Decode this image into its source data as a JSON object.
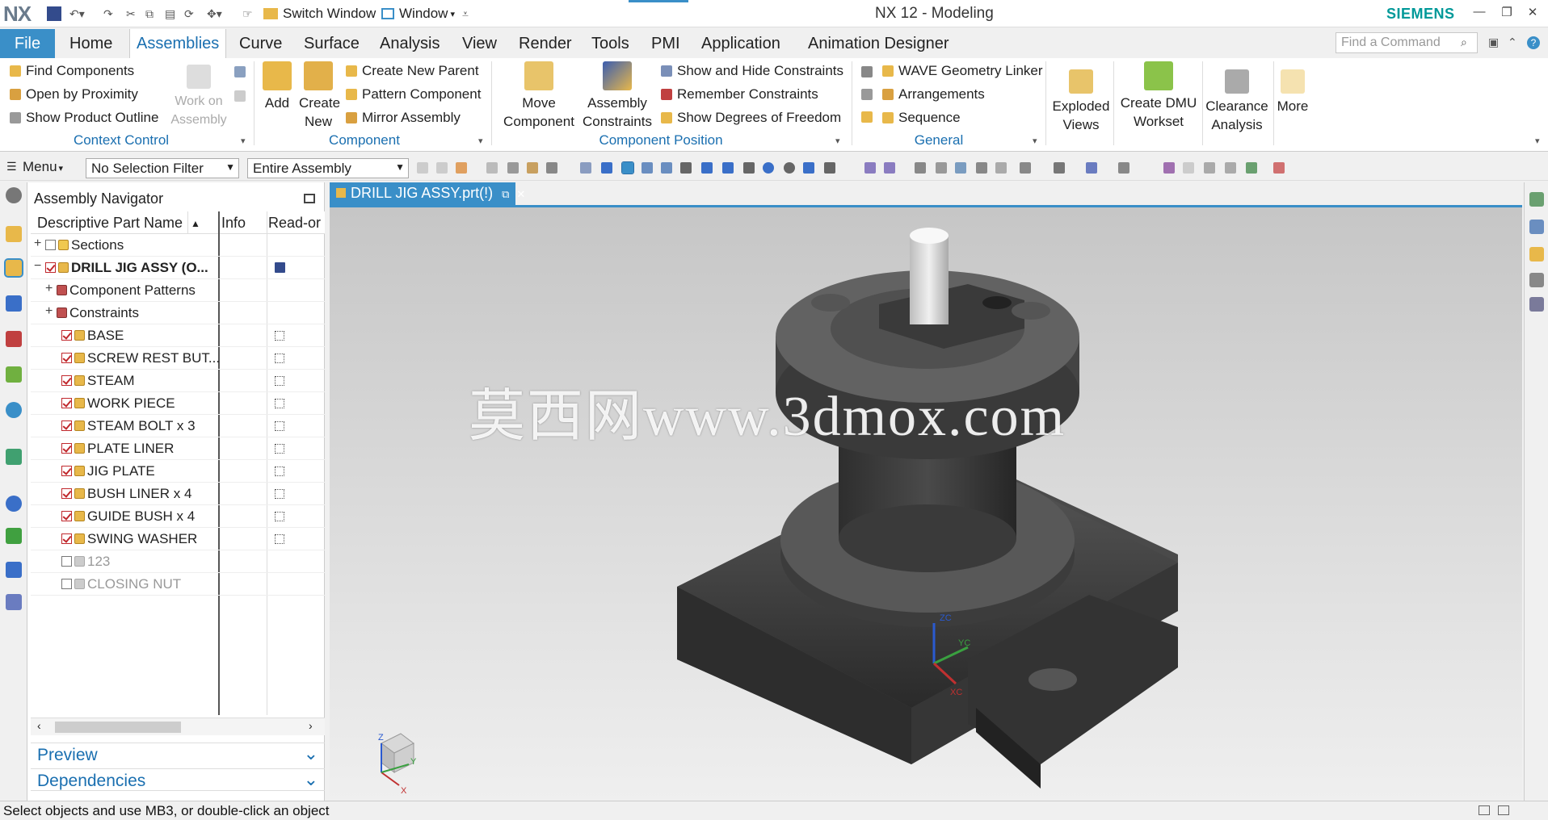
{
  "titlebar": {
    "logo": "NX",
    "switch_window": "Switch Window",
    "window_menu": "Window",
    "app_title": "NX 12 - Modeling",
    "brand": "SIEMENS"
  },
  "tabs": {
    "file": "File",
    "items": [
      "Home",
      "Assemblies",
      "Curve",
      "Surface",
      "Analysis",
      "View",
      "Render",
      "Tools",
      "PMI",
      "Application",
      "Animation Designer"
    ],
    "active": "Assemblies",
    "find_command_placeholder": "Find a Command"
  },
  "ribbon": {
    "context_control": {
      "label": "Context Control",
      "items": [
        "Find Components",
        "Open by Proximity",
        "Show Product Outline"
      ],
      "work_on_assembly": "Work on Assembly"
    },
    "component": {
      "label": "Component",
      "add": "Add",
      "create_new": "Create New",
      "items": [
        "Create New Parent",
        "Pattern Component",
        "Mirror Assembly"
      ]
    },
    "component_position": {
      "label": "Component Position",
      "move_component": "Move Component",
      "assembly_constraints": "Assembly Constraints",
      "items": [
        "Show and Hide Constraints",
        "Remember Constraints",
        "Show Degrees of Freedom"
      ]
    },
    "general": {
      "label": "General",
      "items": [
        "WAVE Geometry Linker",
        "Arrangements",
        "Sequence"
      ]
    },
    "exploded_views": "Exploded Views",
    "create_dmu_worksheet": "Create DMU Workset",
    "clearance_analysis": "Clearance Analysis",
    "more": "More"
  },
  "toolbar2": {
    "menu": "Menu",
    "selection_filter": "No Selection Filter",
    "scope": "Entire Assembly"
  },
  "navigator": {
    "title": "Assembly Navigator",
    "columns": [
      "Descriptive Part Name",
      "Info",
      "Read-or"
    ],
    "rows": [
      {
        "label": "Sections",
        "level": 0,
        "expander": "+",
        "checked": false,
        "bold": false,
        "dim": false,
        "type": "folder"
      },
      {
        "label": "DRILL JIG ASSY (O...",
        "level": 0,
        "expander": "−",
        "checked": true,
        "bold": true,
        "dim": false,
        "type": "assy"
      },
      {
        "label": "Component Patterns",
        "level": 1,
        "expander": "+",
        "checked": null,
        "bold": false,
        "dim": false,
        "type": "pattern"
      },
      {
        "label": "Constraints",
        "level": 1,
        "expander": "+",
        "checked": null,
        "bold": false,
        "dim": false,
        "type": "constraint"
      },
      {
        "label": "BASE",
        "level": 2,
        "expander": "",
        "checked": true,
        "bold": false,
        "dim": false,
        "type": "part"
      },
      {
        "label": "SCREW REST BUT...",
        "level": 2,
        "expander": "",
        "checked": true,
        "bold": false,
        "dim": false,
        "type": "part"
      },
      {
        "label": "STEAM",
        "level": 2,
        "expander": "",
        "checked": true,
        "bold": false,
        "dim": false,
        "type": "part"
      },
      {
        "label": "WORK PIECE",
        "level": 2,
        "expander": "",
        "checked": true,
        "bold": false,
        "dim": false,
        "type": "part"
      },
      {
        "label": "STEAM BOLT x 3",
        "level": 2,
        "expander": "",
        "checked": true,
        "bold": false,
        "dim": false,
        "type": "part"
      },
      {
        "label": "PLATE LINER",
        "level": 2,
        "expander": "",
        "checked": true,
        "bold": false,
        "dim": false,
        "type": "part"
      },
      {
        "label": "JIG PLATE",
        "level": 2,
        "expander": "",
        "checked": true,
        "bold": false,
        "dim": false,
        "type": "part"
      },
      {
        "label": "BUSH LINER x 4",
        "level": 2,
        "expander": "",
        "checked": true,
        "bold": false,
        "dim": false,
        "type": "part"
      },
      {
        "label": "GUIDE BUSH x 4",
        "level": 2,
        "expander": "",
        "checked": true,
        "bold": false,
        "dim": false,
        "type": "part"
      },
      {
        "label": "SWING WASHER",
        "level": 2,
        "expander": "",
        "checked": true,
        "bold": false,
        "dim": false,
        "type": "part"
      },
      {
        "label": "123",
        "level": 2,
        "expander": "",
        "checked": false,
        "bold": false,
        "dim": true,
        "type": "part"
      },
      {
        "label": "CLOSING NUT",
        "level": 2,
        "expander": "",
        "checked": false,
        "bold": false,
        "dim": true,
        "type": "part"
      }
    ],
    "preview": "Preview",
    "dependencies": "Dependencies"
  },
  "graphics": {
    "tab_label": "DRILL JIG ASSY.prt(!)",
    "watermark": "莫西网www.3dmox.com",
    "axis_labels": {
      "z": "Z",
      "x": "X",
      "y": "Y",
      "zc": "ZC",
      "xc": "XC",
      "yc": "YC"
    }
  },
  "status": {
    "text": "Select objects and use MB3, or double-click an object"
  },
  "colors": {
    "accent": "#3a8fc8",
    "brand": "#009999",
    "check_red": "#c0282d"
  }
}
